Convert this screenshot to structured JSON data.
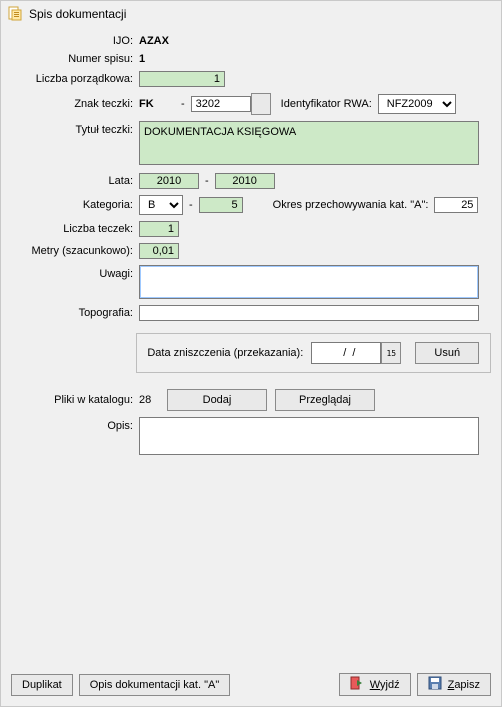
{
  "window": {
    "title": "Spis dokumentacji"
  },
  "labels": {
    "ijo": "IJO:",
    "numer_spisu": "Numer spisu:",
    "liczba_porzadkowa": "Liczba porządkowa:",
    "znak_teczki": "Znak teczki:",
    "ident_rwa": "Identyfikator RWA:",
    "tytul_teczki": "Tytuł teczki:",
    "lata": "Lata:",
    "kategoria": "Kategoria:",
    "okres_kat_a": "Okres przechowywania kat. \"A\":",
    "liczba_teczek": "Liczba teczek:",
    "metry": "Metry (szacunkowo):",
    "uwagi": "Uwagi:",
    "topografia": "Topografia:",
    "data_zniszczenia": "Data zniszczenia (przekazania):",
    "pliki": "Pliki w katalogu:",
    "opis": "Opis:"
  },
  "values": {
    "ijo": "AZAX",
    "numer_spisu": "1",
    "liczba_porzadkowa": "1",
    "znak_teczki_prefix": "FK",
    "znak_teczki_code": "3202",
    "ident_rwa": "NFZ2009",
    "tytul_teczki": "DOKUMENTACJA KSIĘGOWA",
    "lata_od": "2010",
    "lata_do": "2010",
    "kategoria": "B",
    "kategoria_num": "5",
    "okres_kat_a": "25",
    "liczba_teczek": "1",
    "metry": "0,01",
    "uwagi": "",
    "topografia": "",
    "data_zniszczenia": "  /  /",
    "pliki": "28",
    "opis": ""
  },
  "buttons": {
    "usun": "Usuń",
    "dodaj": "Dodaj",
    "przegladaj": "Przeglądaj",
    "duplikat": "Duplikat",
    "opis_kat_a": "Opis dokumentacji kat. \"A\"",
    "wyjdz": "Wyjdź",
    "zapisz": "Zapisz"
  },
  "icons": {
    "app": "📄",
    "calendar": "15",
    "exit": "📕",
    "save": "💾"
  }
}
